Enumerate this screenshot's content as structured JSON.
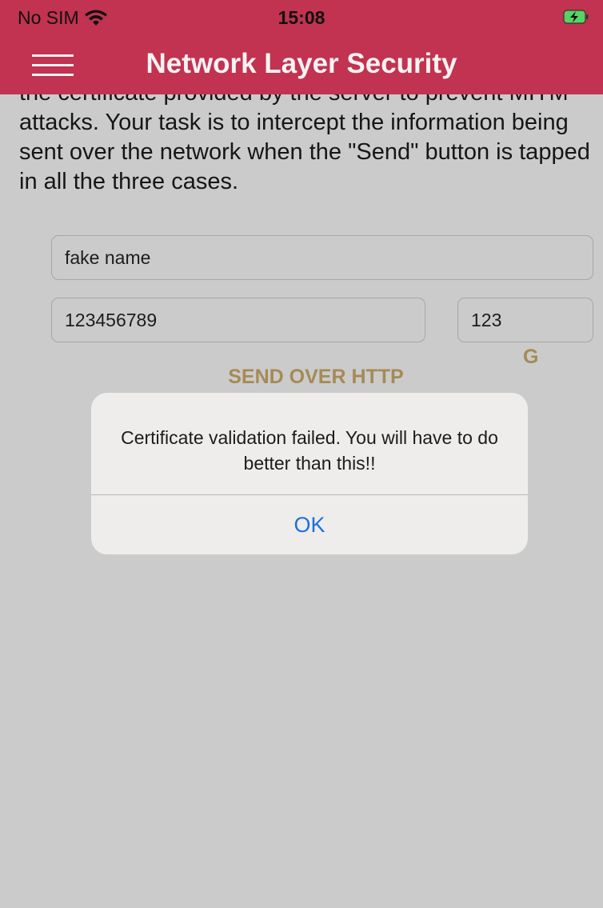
{
  "status_bar": {
    "carrier": "No SIM",
    "time": "15:08",
    "wifi_icon": "wifi-icon",
    "battery_icon": "battery-charging-icon"
  },
  "nav": {
    "title": "Network Layer Security",
    "menu_icon": "hamburger-menu-icon"
  },
  "content": {
    "description_partial": "the certificate provided by the server to prevent MITM attacks. Your task is to intercept the information being sent over the network when the \"Send\" button is tapped in all the three cases.",
    "name_value": "fake name",
    "card_value": "123456789",
    "cvv_value": "123",
    "send_http_label": "SEND OVER HTTP",
    "obscured_char": "G"
  },
  "alert": {
    "message": "Certificate validation failed. You will have to do better than this!!",
    "ok_label": "OK"
  },
  "colors": {
    "header": "#c13350",
    "background": "#cbcbcb",
    "accent_text": "#a68a55",
    "link_blue": "#1d6fdb"
  }
}
